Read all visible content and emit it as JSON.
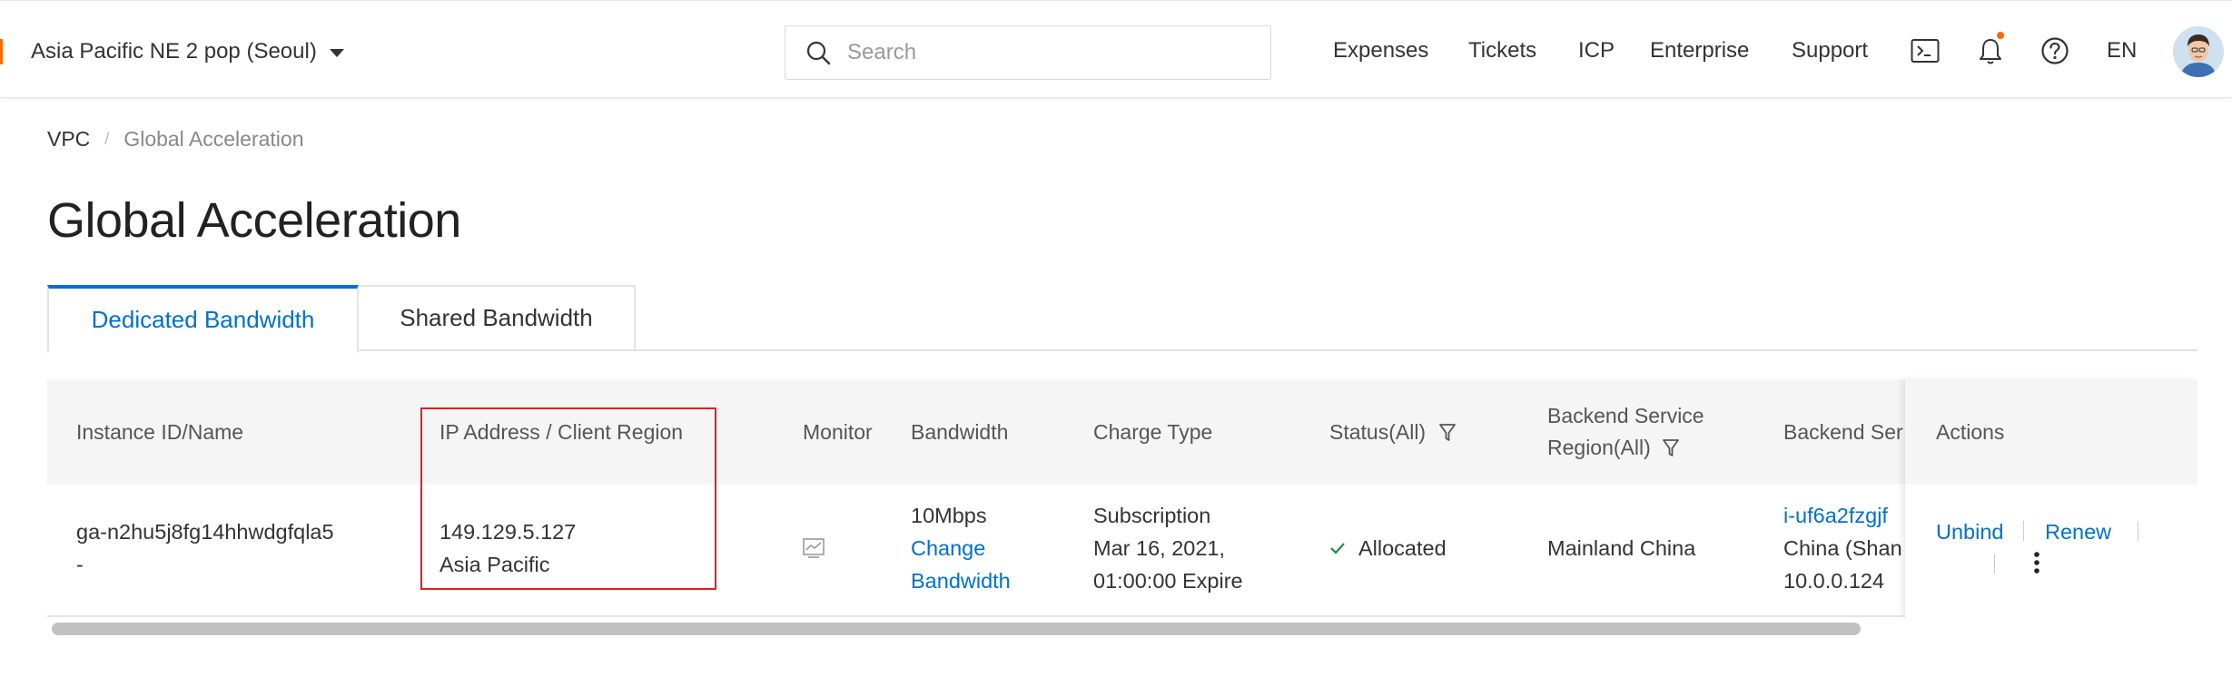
{
  "header": {
    "region": "Asia Pacific NE 2 pop (Seoul)",
    "search_placeholder": "Search",
    "search_value": "",
    "nav": {
      "expenses": "Expenses",
      "tickets": "Tickets",
      "icp": "ICP",
      "enterprise": "Enterprise",
      "support": "Support",
      "language": "EN"
    },
    "icons": [
      "terminal-icon",
      "bell-icon",
      "help-icon"
    ],
    "accent_color": "#ff6a00"
  },
  "breadcrumb": {
    "root": "VPC",
    "separator": "/",
    "current": "Global Acceleration"
  },
  "page": {
    "title": "Global Acceleration"
  },
  "tabs": [
    {
      "label": "Dedicated Bandwidth",
      "active": true
    },
    {
      "label": "Shared Bandwidth",
      "active": false
    }
  ],
  "table": {
    "columns": {
      "instance": "Instance ID/Name",
      "ip": "IP Address / Client Region",
      "monitor": "Monitor",
      "bandwidth": "Bandwidth",
      "charge": "Charge Type",
      "status": "Status(All)",
      "backend_region_1": "Backend Service",
      "backend_region_2": "Region(All)",
      "backend_service": "Backend Ser",
      "actions": "Actions"
    },
    "rows": [
      {
        "instance_id": "ga-n2hu5j8fg14hhwdgfqla5",
        "instance_name": "-",
        "ip": "149.129.5.127",
        "client_region": "Asia Pacific",
        "bandwidth": "10Mbps",
        "change_bandwidth_1": "Change",
        "change_bandwidth_2": "Bandwidth",
        "charge_type": "Subscription",
        "charge_date": "Mar 16, 2021,",
        "charge_expire": "01:00:00 Expire",
        "status": "Allocated",
        "backend_region": "Mainland China",
        "backend_id": "i-uf6a2fzgjf",
        "backend_location": "China (Shan",
        "backend_ip": "10.0.0.124",
        "actions": {
          "unbind": "Unbind",
          "renew": "Renew"
        }
      }
    ]
  },
  "colors": {
    "link": "#0070cc",
    "highlight": "#e02020",
    "status_ok": "#1e8e3e"
  }
}
